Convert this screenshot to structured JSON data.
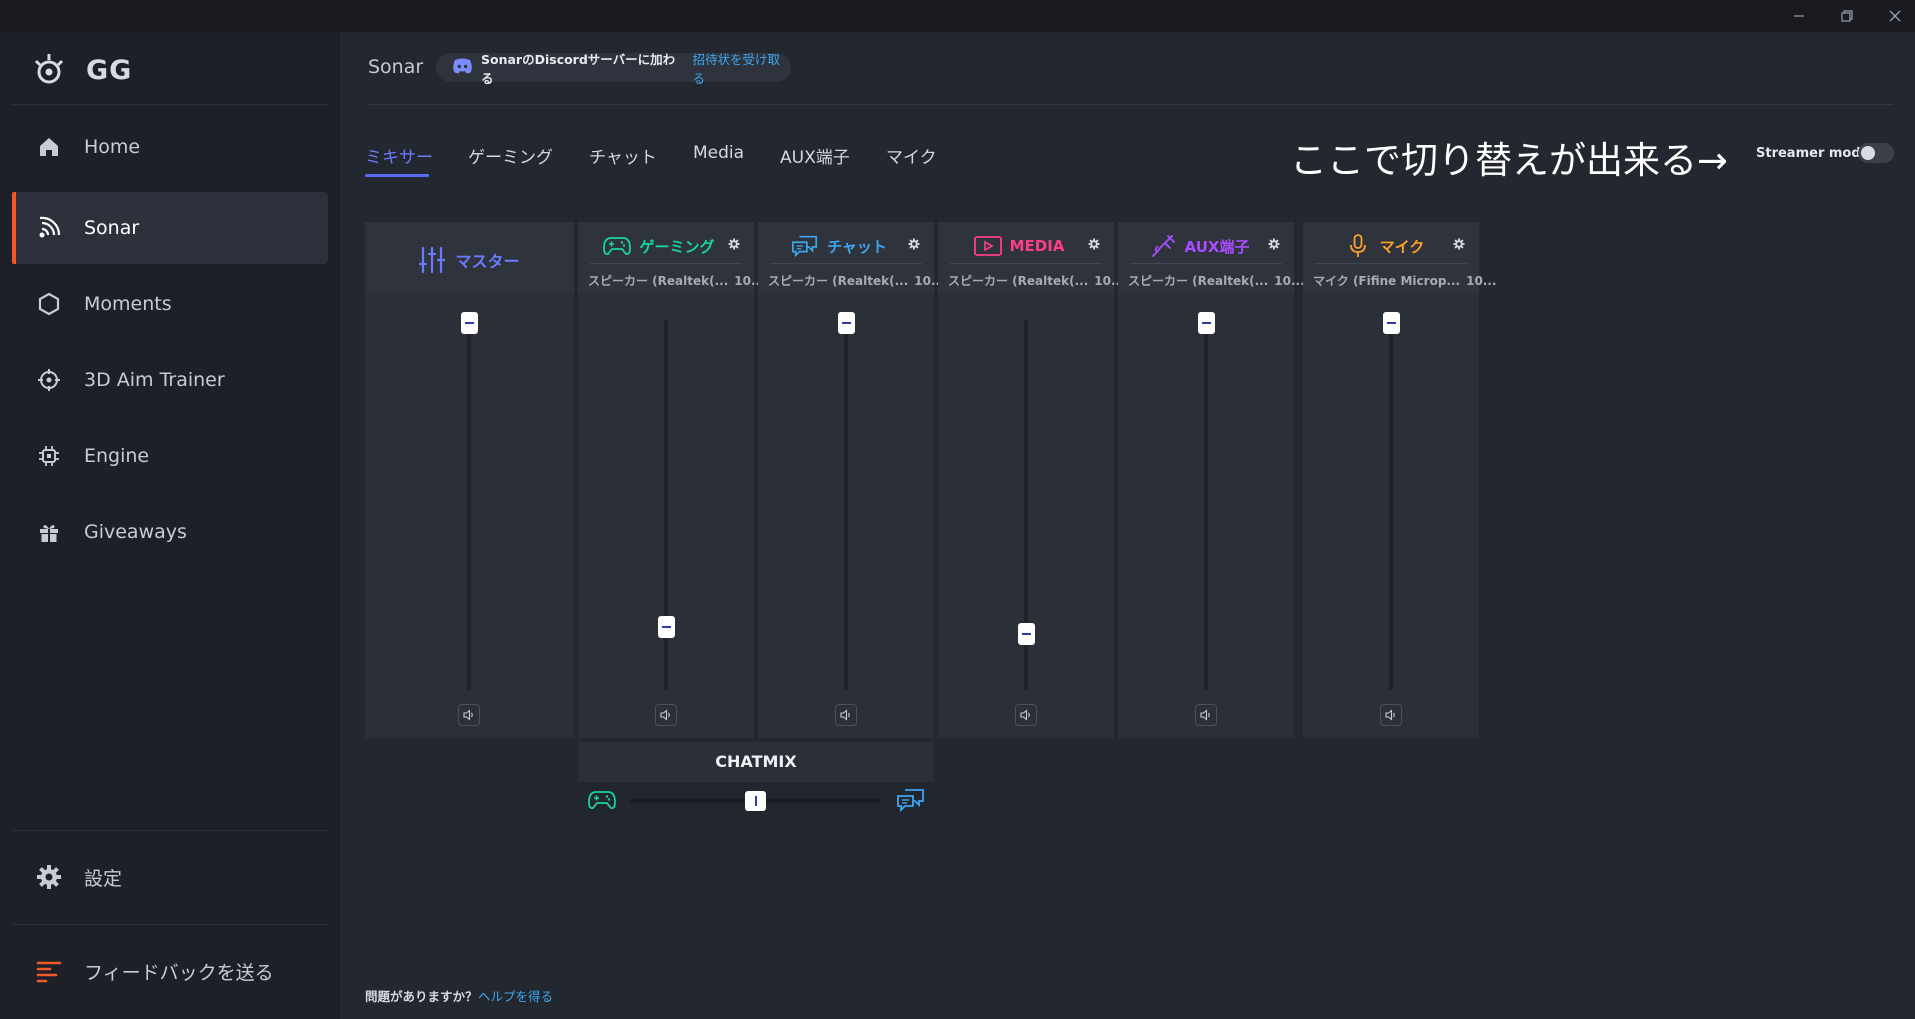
{
  "window": {
    "minimize_icon": "minimize-icon",
    "restore_icon": "restore-icon",
    "close_icon": "close-icon"
  },
  "sidebar": {
    "logo_text": "GG",
    "items": [
      {
        "label": "Home",
        "icon": "home-icon"
      },
      {
        "label": "Sonar",
        "icon": "sonar-icon",
        "active": true
      },
      {
        "label": "Moments",
        "icon": "hexagon-icon"
      },
      {
        "label": "3D Aim Trainer",
        "icon": "crosshair-icon"
      },
      {
        "label": "Engine",
        "icon": "chip-icon"
      },
      {
        "label": "Giveaways",
        "icon": "gift-icon"
      }
    ],
    "settings_label": "設定",
    "feedback_label": "フィードバックを送る"
  },
  "header": {
    "title": "Sonar",
    "discord_text": "SonarのDiscordサーバーに加わる",
    "discord_link": "招待状を受け取る"
  },
  "tabs": [
    {
      "label": "ミキサー",
      "active": true
    },
    {
      "label": "ゲーミング"
    },
    {
      "label": "チャット"
    },
    {
      "label": "Media"
    },
    {
      "label": "AUX端子"
    },
    {
      "label": "マイク"
    }
  ],
  "annotation": "ここで切り替えが出来る→",
  "streamer_mode": {
    "label": "Streamer mode",
    "enabled": false
  },
  "mixer": {
    "master": {
      "label": "マスター",
      "level": 1.0,
      "color": "#6b7bff"
    },
    "channels": [
      {
        "id": "gaming",
        "label": "ゲーミング",
        "device": "スピーカー (Realtek(...",
        "percent": "10...",
        "level": 0.12,
        "color": "#19d3a2"
      },
      {
        "id": "chat",
        "label": "チャット",
        "device": "スピーカー (Realtek(...",
        "percent": "10...",
        "level": 1.0,
        "color": "#3da7f0"
      },
      {
        "id": "media",
        "label": "MEDIA",
        "device": "スピーカー (Realtek(...",
        "percent": "10...",
        "level": 0.1,
        "color": "#ff3d8a"
      },
      {
        "id": "aux",
        "label": "AUX端子",
        "device": "スピーカー (Realtek(...",
        "percent": "10...",
        "level": 1.0,
        "color": "#a94dff"
      },
      {
        "id": "mic",
        "label": "マイク",
        "device": "マイク (Fifine Microp...",
        "percent": "10...",
        "level": 1.0,
        "color": "#ff9f2e"
      }
    ]
  },
  "chatmix": {
    "title": "CHATMIX",
    "balance": 0.5
  },
  "footer": {
    "help_text": "問題がありますか？",
    "help_link": "ヘルプを得る"
  }
}
